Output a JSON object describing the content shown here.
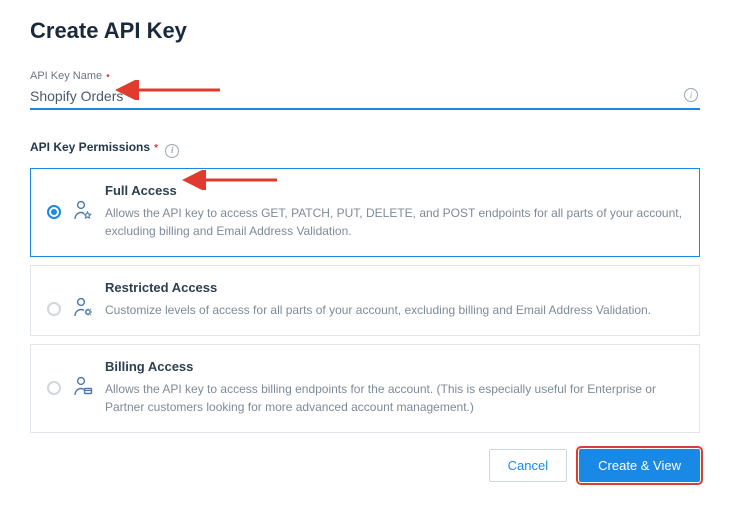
{
  "title": "Create API Key",
  "name_field": {
    "label": "API Key Name",
    "value": "Shopify Orders"
  },
  "permissions_label": "API Key Permissions",
  "options": [
    {
      "title": "Full Access",
      "desc": "Allows the API key to access GET, PATCH, PUT, DELETE, and POST endpoints for all parts of your account, excluding billing and Email Address Validation."
    },
    {
      "title": "Restricted Access",
      "desc": "Customize levels of access for all parts of your account, excluding billing and Email Address Validation."
    },
    {
      "title": "Billing Access",
      "desc": "Allows the API key to access billing endpoints for the account. (This is especially useful for Enterprise or Partner customers looking for more advanced account management.)"
    }
  ],
  "actions": {
    "cancel": "Cancel",
    "submit": "Create & View"
  }
}
